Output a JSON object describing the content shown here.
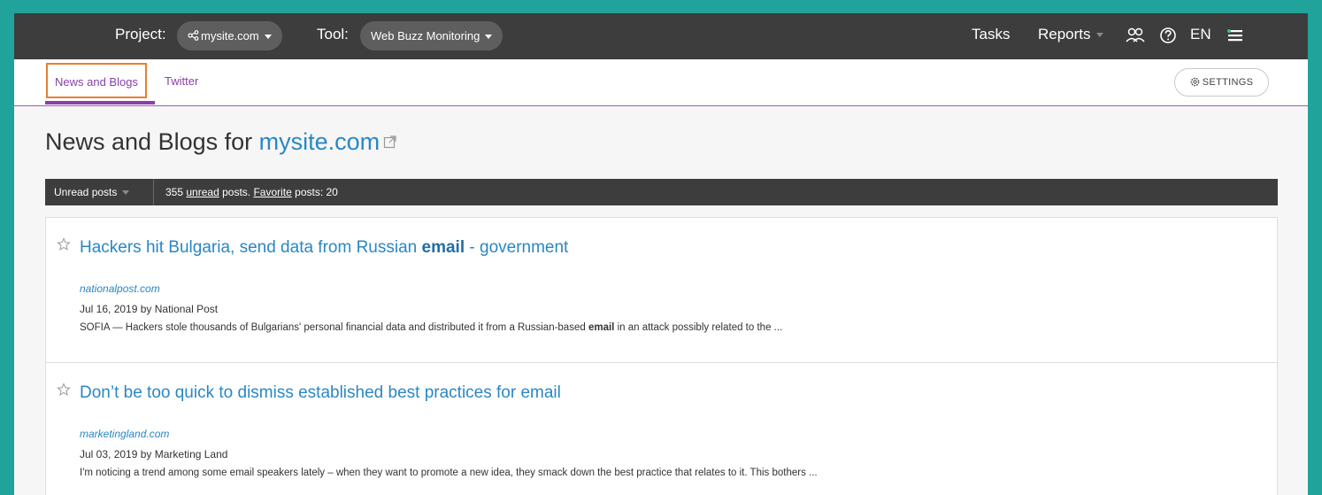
{
  "header": {
    "project_label": "Project:",
    "project_value": "mysite.com",
    "tool_label": "Tool:",
    "tool_value": "Web Buzz Monitoring",
    "tasks": "Tasks",
    "reports": "Reports",
    "language": "EN",
    "icons": [
      "share-icon",
      "users-icon",
      "help-icon",
      "menu-icon"
    ]
  },
  "tabs": [
    {
      "label": "News and Blogs",
      "active": true
    },
    {
      "label": "Twitter",
      "active": false
    }
  ],
  "settings_label": "SETTINGS",
  "page": {
    "heading_prefix": "News and Blogs for",
    "heading_site": "mysite.com"
  },
  "filter": {
    "selected": "Unread posts",
    "unread_count": "355",
    "unread_word": "unread",
    "posts_text": "posts.",
    "favorite_word": "Favorite",
    "favorite_text": "posts: 20"
  },
  "posts": [
    {
      "title_before": "Hackers hit Bulgaria, send data from Russian",
      "title_highlight": "email",
      "title_after": "- government",
      "source": "nationalpost.com",
      "meta": "Jul 16, 2019 by National Post",
      "snippet_before": "SOFIA — Hackers stole thousands of Bulgarians' personal financial data and distributed it from a Russian-based",
      "snippet_highlight": "email",
      "snippet_after": "in an attack possibly related to the ..."
    },
    {
      "title": "Don’t be too quick to dismiss established best practices for email",
      "source": "marketingland.com",
      "meta": "Jul 03, 2019 by Marketing Land",
      "snippet": "I'm noticing a trend among some email speakers lately – when they want to promote a new idea, they smack down the best practice that relates to it. This bothers ..."
    }
  ],
  "colors": {
    "frame": "#1fa39b",
    "topbar": "#3d3d3d",
    "accent_purple": "#8a3fa8",
    "link_blue": "#2a87c4",
    "highlight_orange": "#e87f2d"
  }
}
